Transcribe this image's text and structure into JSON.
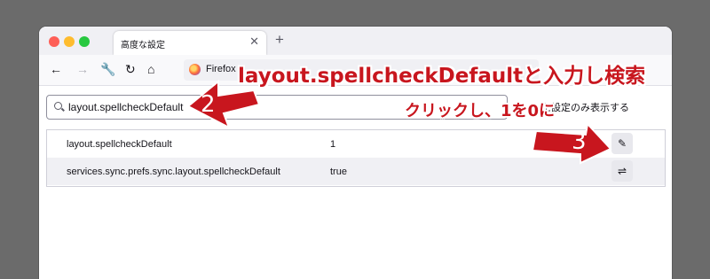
{
  "tab": {
    "title": "高度な設定",
    "close_icon": "close-icon",
    "new_tab_icon": "plus-icon"
  },
  "navbar": {
    "back_icon": "←",
    "forward_icon": "→",
    "tools_icon": "🔧",
    "reload_icon": "↻",
    "home_icon": "⌂",
    "url_label": "Firefox"
  },
  "search": {
    "value": "layout.spellcheckDefault"
  },
  "modified_only_label": "た設定のみ表示する",
  "prefs": [
    {
      "name": "layout.spellcheckDefault",
      "value": "1",
      "action_icon": "✎"
    },
    {
      "name": "services.sync.prefs.sync.layout.spellcheckDefault",
      "value": "true",
      "action_icon": "⇌"
    }
  ],
  "annotations": {
    "top_text": "layout.spellcheckDefaultと入力し検索",
    "mid_text": "クリックし、1を0に",
    "step2": "2",
    "step3": "3"
  },
  "colors": {
    "accent_red": "#c8161e",
    "background": "#6b6b6b"
  }
}
